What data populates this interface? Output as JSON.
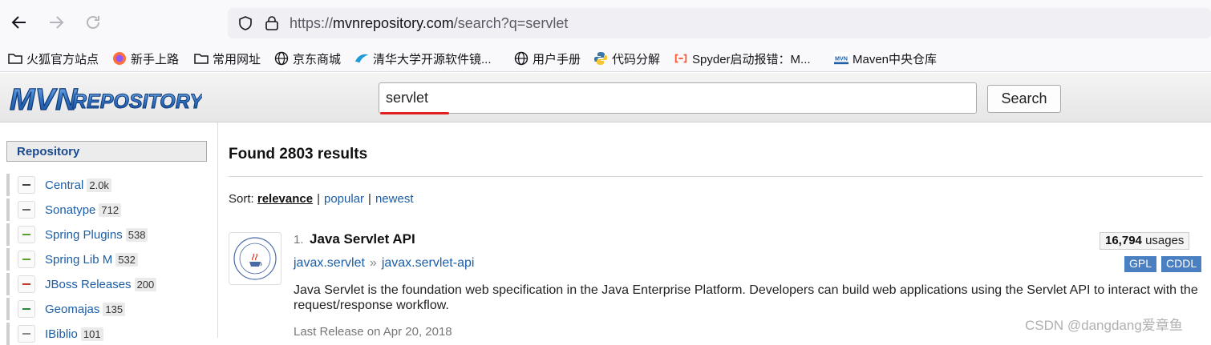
{
  "browser": {
    "url_prefix": "https://",
    "url_domain": "mvnrepository.com",
    "url_path": "/search?q=servlet"
  },
  "bookmarks": [
    {
      "label": "火狐官方站点",
      "icon": "folder-icon"
    },
    {
      "label": "新手上路",
      "icon": "firefox-icon"
    },
    {
      "label": "常用网址",
      "icon": "folder-icon"
    },
    {
      "label": "京东商城",
      "icon": "globe-icon"
    },
    {
      "label": "清华大学开源软件镜...",
      "icon": "mirror-icon"
    },
    {
      "label": "用户手册",
      "icon": "globe-icon"
    },
    {
      "label": "代码分解",
      "icon": "python-icon"
    },
    {
      "label": "Spyder启动报错：M...",
      "icon": "csdn-icon"
    },
    {
      "label": "Maven中央仓库",
      "icon": "mvn-icon"
    }
  ],
  "site": {
    "logo_text": "MVNREPOSITORY",
    "search_value": "servlet",
    "search_button": "Search"
  },
  "sidebar": {
    "heading": "Repository",
    "items": [
      {
        "name": "Central",
        "count": "2.0k"
      },
      {
        "name": "Sonatype",
        "count": "712"
      },
      {
        "name": "Spring Plugins",
        "count": "538"
      },
      {
        "name": "Spring Lib M",
        "count": "532"
      },
      {
        "name": "JBoss Releases",
        "count": "200"
      },
      {
        "name": "Geomajas",
        "count": "135"
      },
      {
        "name": "IBiblio",
        "count": "101"
      }
    ]
  },
  "main": {
    "results_title": "Found 2803 results",
    "sort_label": "Sort:",
    "sort_options": [
      "relevance",
      "popular",
      "newest"
    ],
    "sort_separator": "|"
  },
  "result": {
    "number": "1.",
    "title": "Java Servlet API",
    "group": "javax.servlet",
    "arrow": "»",
    "artifact": "javax.servlet-api",
    "usage_count": "16,794",
    "usage_label": "usages",
    "licenses": [
      "GPL",
      "CDDL"
    ],
    "description": "Java Servlet is the foundation web specification in the Java Enterprise Platform. Developers can build web applications using the Servlet API to interact with the request/response workflow.",
    "last_release": "Last Release on Apr 20, 2018"
  },
  "watermark": "CSDN @dangdang爱章鱼",
  "colors": {
    "link": "#1b5ea8",
    "license_badge": "#4a7fc1",
    "underline": "#e02020"
  }
}
